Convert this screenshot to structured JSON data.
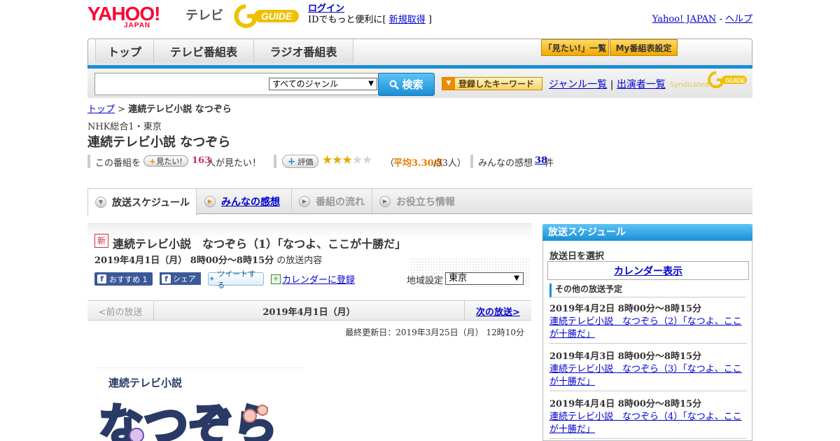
{
  "header": {
    "logo_yahoo": "YAHOO!",
    "logo_japan": "JAPAN",
    "logo_tv": "テレビ",
    "login_label": "ログイン",
    "login_text_pre": "IDでもっと便利に[ ",
    "register_label": "新規取得",
    "login_text_post": " ]",
    "yahoo_japan_link": "Yahoo! JAPAN",
    "link_sep": " - ",
    "help_link": "ヘルプ"
  },
  "nav": {
    "tabs": [
      {
        "label": "トップ"
      },
      {
        "label": "テレビ番組表"
      },
      {
        "label": "ラジオ番組表"
      }
    ],
    "want_list_label": "「見たい!」一覧",
    "my_schedule_label": "My番組表設定"
  },
  "search": {
    "query": "",
    "genre_selected": "すべてのジャンル",
    "search_button": "検索",
    "keyword_button": "登録したキーワード",
    "genre_list_link": "ジャンル一覧",
    "link_sep": " | ",
    "performer_list_link": "出演者一覧",
    "syndicated_text": "Syndicated"
  },
  "breadcrumb": {
    "top": "トップ",
    "sep": " > ",
    "current": "連続テレビ小説 なつぞら"
  },
  "program": {
    "channel": "NHK総合1・東京",
    "title": "連続テレビ小説 なつぞら",
    "want_prefix": "この番組を",
    "want_button": "見たい!",
    "want_count": "163",
    "want_suffix": "人が見たい！",
    "eval_button": "評価",
    "rating_stars": 3,
    "rating_max": 5,
    "rating_open": "（",
    "rating_avg": "平均3.30点",
    "rating_count": "/33人）",
    "reviews_prefix": "みんなの感想",
    "reviews_count": "38",
    "reviews_suffix": "件"
  },
  "subtabs": [
    {
      "label": "放送スケジュール",
      "active": true
    },
    {
      "label": "みんなの感想",
      "link": true
    },
    {
      "label": "番組の流れ"
    },
    {
      "label": "お役立ち情報"
    }
  ],
  "episode": {
    "new_badge": "新",
    "title": "連続テレビ小説　なつぞら（1）「なつよ、ここが十勝だ」",
    "date_time": "2019年4月1日（月）  8時00分～8時15分",
    "date_time_suffix": " の放送内容",
    "fb_recommend": "おすすめ 1",
    "fb_share": "シェア",
    "tweet": "ツイートする",
    "calendar_link": "カレンダーに登録",
    "region_label": "地域設定",
    "region_selected": "東京"
  },
  "pager": {
    "prev": "<前の放送",
    "current": "2019年4月1日（月）",
    "next": "次の放送>"
  },
  "updated": "最終更新日：2019年3月25日（月）  12時10分",
  "thumbnail": {
    "caption": "連続テレビ小説",
    "logo_text": "なつぞら"
  },
  "side": {
    "header": "放送スケジュール",
    "pick_date": "放送日を選択",
    "calendar_link": "カレンダー表示",
    "other_header": "その他の放送予定",
    "items": [
      {
        "date": "2019年4月2日  8時00分～8時15分",
        "title": "連続テレビ小説　なつぞら（2）「なつよ、ここが十勝だ」"
      },
      {
        "date": "2019年4月3日  8時00分～8時15分",
        "title": "連続テレビ小説　なつぞら（3）「なつよ、ここが十勝だ」"
      },
      {
        "date": "2019年4月4日  8時00分～8時15分",
        "title": "連続テレビ小説　なつぞら（4）「なつよ、ここが十勝だ」"
      }
    ]
  },
  "colors": {
    "brand_red": "#ff0033",
    "accent_blue": "#1a8fd6",
    "star_gold": "#e8a900",
    "rating_orange": "#e87a00",
    "count_red": "#cc3366"
  }
}
